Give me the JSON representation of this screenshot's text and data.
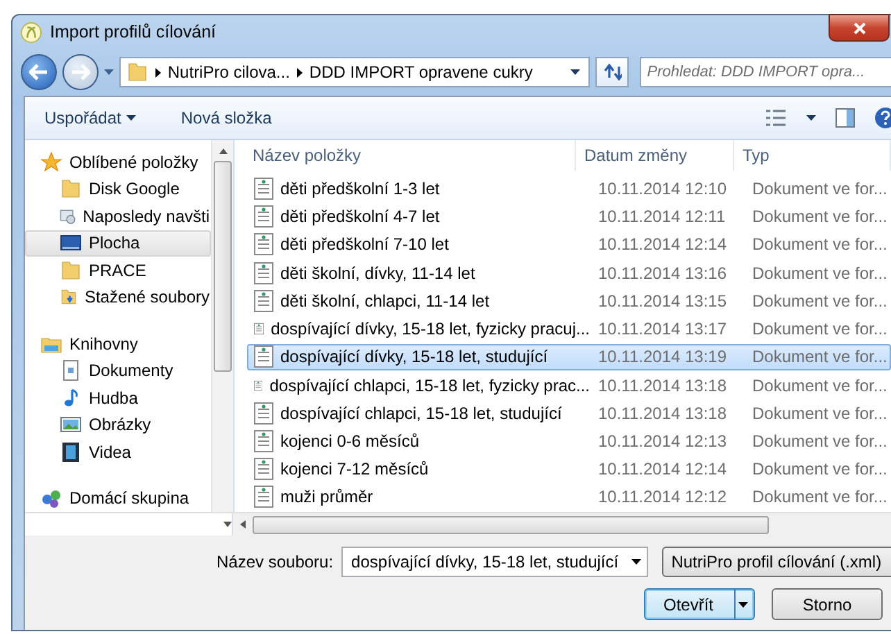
{
  "window": {
    "title": "Import profilů cílování"
  },
  "address": {
    "crumbs": [
      "NutriPro cilova...",
      "DDD IMPORT opravene cukry"
    ]
  },
  "search": {
    "placeholder": "Prohledat: DDD IMPORT opra..."
  },
  "toolbar": {
    "buttons": [
      {
        "label": "Uspořádat",
        "dropdown": true
      },
      {
        "label": "Nová složka",
        "dropdown": false
      }
    ]
  },
  "sidebar": {
    "groups": [
      {
        "label": "Oblíbené položky",
        "kind": "star",
        "selected": false,
        "items": [
          {
            "label": "Disk Google",
            "kind": "folder",
            "selected": false
          },
          {
            "label": "Naposledy navšti",
            "kind": "recent",
            "selected": false
          },
          {
            "label": "Plocha",
            "kind": "desktop",
            "selected": true
          },
          {
            "label": "PRACE",
            "kind": "folder",
            "selected": false
          },
          {
            "label": "Stažené soubory",
            "kind": "download",
            "selected": false
          }
        ]
      },
      {
        "label": "Knihovny",
        "kind": "library",
        "selected": false,
        "items": [
          {
            "label": "Dokumenty",
            "kind": "document",
            "selected": false
          },
          {
            "label": "Hudba",
            "kind": "music",
            "selected": false
          },
          {
            "label": "Obrázky",
            "kind": "picture",
            "selected": false
          },
          {
            "label": "Videa",
            "kind": "video",
            "selected": false
          }
        ]
      },
      {
        "label": "Domácí skupina",
        "kind": "homegroup",
        "selected": false
      }
    ]
  },
  "table": {
    "columns": [
      "Název položky",
      "Datum změny",
      "Typ"
    ],
    "rows": [
      {
        "name": "děti předškolní 1-3 let",
        "date": "10.11.2014 12:10",
        "type": "Dokument ve for...",
        "selected": false
      },
      {
        "name": "děti předškolní 4-7 let",
        "date": "10.11.2014 12:11",
        "type": "Dokument ve for...",
        "selected": false
      },
      {
        "name": "děti předškolní 7-10 let",
        "date": "10.11.2014 12:14",
        "type": "Dokument ve for...",
        "selected": false
      },
      {
        "name": "děti školní, dívky, 11-14 let",
        "date": "10.11.2014 13:16",
        "type": "Dokument ve for...",
        "selected": false
      },
      {
        "name": "děti školní, chlapci, 11-14 let",
        "date": "10.11.2014 13:15",
        "type": "Dokument ve for...",
        "selected": false
      },
      {
        "name": "dospívající dívky, 15-18 let, fyzicky pracuj...",
        "date": "10.11.2014 13:17",
        "type": "Dokument ve for...",
        "selected": false
      },
      {
        "name": "dospívající dívky, 15-18 let, studující",
        "date": "10.11.2014 13:19",
        "type": "Dokument ve for...",
        "selected": true
      },
      {
        "name": "dospívající chlapci, 15-18 let, fyzicky prac...",
        "date": "10.11.2014 13:18",
        "type": "Dokument ve for...",
        "selected": false
      },
      {
        "name": "dospívající chlapci, 15-18 let, studující",
        "date": "10.11.2014 13:18",
        "type": "Dokument ve for...",
        "selected": false
      },
      {
        "name": "kojenci 0-6 měsíců",
        "date": "10.11.2014 12:13",
        "type": "Dokument ve for...",
        "selected": false
      },
      {
        "name": "kojenci 7-12 měsíců",
        "date": "10.11.2014 12:14",
        "type": "Dokument ve for...",
        "selected": false
      },
      {
        "name": "muži průměr",
        "date": "10.11.2014 12:12",
        "type": "Dokument ve for...",
        "selected": false
      }
    ]
  },
  "filename": {
    "label": "Název souboru:",
    "value": "dospívající dívky, 15-18 let, studující"
  },
  "filetype": {
    "value": "NutriPro profil cílování (.xml)"
  },
  "buttons": [
    {
      "label": "Otevřít",
      "kind": "split",
      "default": true
    },
    {
      "label": "Storno",
      "kind": "plain",
      "default": false
    }
  ]
}
